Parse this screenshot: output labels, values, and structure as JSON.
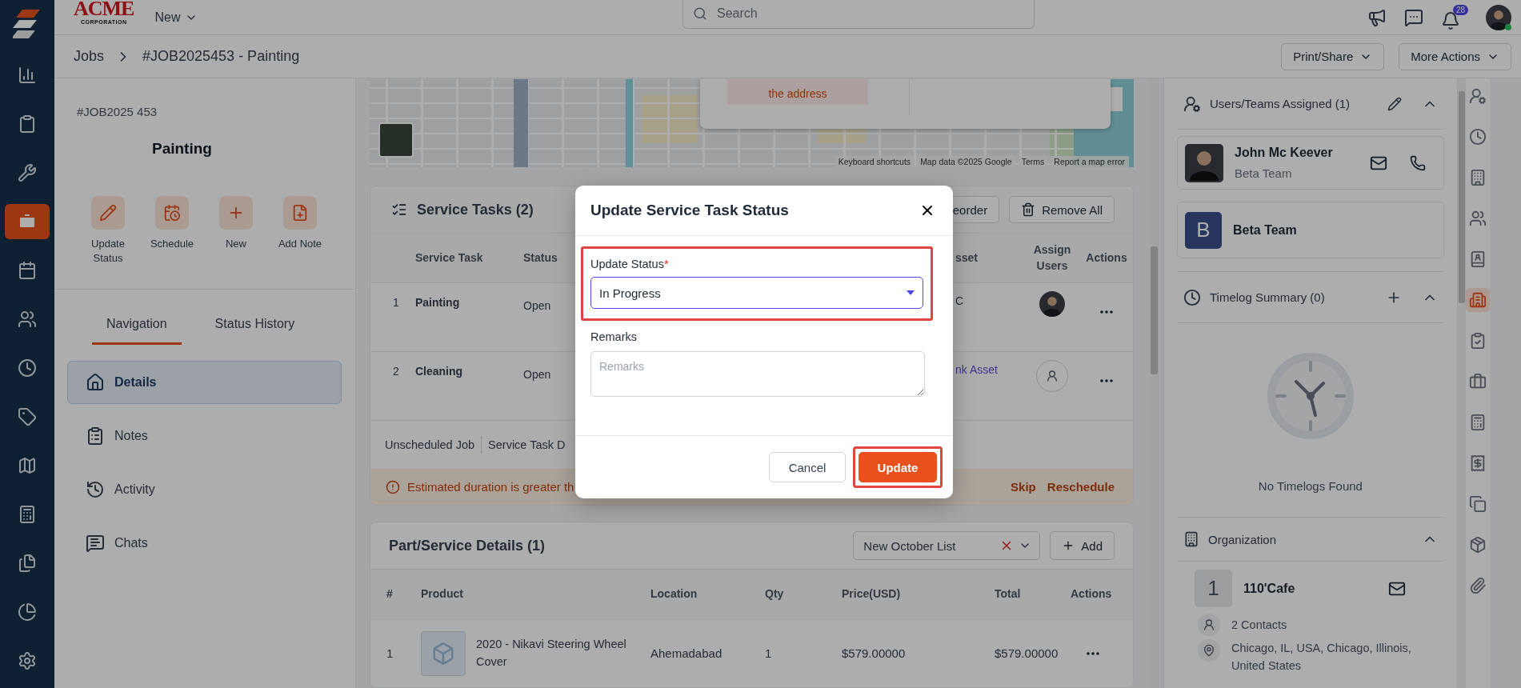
{
  "app_rail": [
    {
      "selected": false
    },
    {
      "selected": false
    },
    {
      "selected": false
    },
    {
      "selected": true
    },
    {
      "selected": false
    },
    {
      "selected": false
    },
    {
      "selected": false
    },
    {
      "selected": false
    },
    {
      "selected": false
    },
    {
      "selected": false
    },
    {
      "selected": false
    },
    {
      "selected": false
    },
    {
      "selected": false
    }
  ],
  "top_bar": {
    "brand": "ACME",
    "brand_tagline": "CORPORATION",
    "new_menu": "New",
    "search": {
      "placeholder": "Search"
    },
    "notification_count": "28"
  },
  "breadcrumb": [
    "Jobs",
    "#JOB2025453 - Painting"
  ],
  "header_actions": [
    "Print/Share",
    "More Actions"
  ],
  "job": {
    "number": "#JOB2025 453",
    "title": "Painting",
    "quick_actions": [
      "Update Status",
      "Schedule",
      "New",
      "Add Note"
    ]
  },
  "tabs": [
    {
      "label": "Navigation",
      "selected": true
    },
    {
      "label": "Status History",
      "selected": false
    }
  ],
  "nav": [
    {
      "label": "Details",
      "selected": true
    },
    {
      "label": "Notes",
      "selected": false
    },
    {
      "label": "Activity",
      "selected": false
    },
    {
      "label": "Chats",
      "selected": false
    }
  ],
  "map": {
    "popup_text": "the address",
    "attribution": [
      "Keyboard shortcuts",
      "Map data ©2025 Google",
      "Terms",
      "Report a map error"
    ]
  },
  "service_tasks": {
    "title": "Service Tasks (2)",
    "buttons": [
      "eorder",
      "Remove All"
    ],
    "columns": [
      "Service Task",
      "Status",
      "sset",
      "Assign Users",
      "Actions"
    ],
    "rows": [
      {
        "index": "1",
        "task": "Painting",
        "status": "Open",
        "asset": {
          "text": "C",
          "kind": "text"
        },
        "assignee": {
          "kind": "avatar"
        }
      },
      {
        "index": "2",
        "task": "Cleaning",
        "status": "Open",
        "asset": {
          "text": "nk Asset",
          "kind": "link"
        },
        "assignee": {
          "kind": "empty"
        }
      }
    ],
    "footer": [
      "Unscheduled Job",
      "Service Task D"
    ],
    "warning": {
      "text": "Estimated duration is greater th",
      "actions": [
        "Skip",
        "Reschedule"
      ]
    }
  },
  "parts": {
    "title": "Part/Service Details (1)",
    "price_list": "New October List",
    "add_button": "Add",
    "columns": [
      "#",
      "Product",
      "Location",
      "Qty",
      "Price(USD)",
      "Total",
      "Actions"
    ],
    "rows": [
      {
        "index": "1",
        "product": "2020 - Nikavi Steering Wheel Cover",
        "location": "Ahemadabad",
        "qty": "1",
        "price": "$579.00000",
        "total": "$579.00000"
      }
    ]
  },
  "right_panel": {
    "assigned": {
      "title": "Users/Teams Assigned (1)",
      "members": [
        {
          "kind": "user",
          "name": "John Mc Keever",
          "team": "Beta Team"
        },
        {
          "kind": "team",
          "initial": "B",
          "name": "Beta Team"
        }
      ]
    },
    "timelog": {
      "title": "Timelog Summary (0)",
      "empty_text": "No Timelogs Found"
    },
    "organization": {
      "title": "Organization",
      "initial": "1",
      "name": "110'Cafe",
      "contacts": "2 Contacts",
      "address": "Chicago, IL, USA, Chicago, Illinois, United States"
    }
  },
  "side_rail": [
    {
      "selected": false
    },
    {
      "selected": false
    },
    {
      "selected": false
    },
    {
      "selected": false
    },
    {
      "selected": false
    },
    {
      "selected": true
    },
    {
      "selected": false
    },
    {
      "selected": false
    },
    {
      "selected": false
    },
    {
      "selected": false
    },
    {
      "selected": false
    },
    {
      "selected": false
    },
    {
      "selected": false
    }
  ],
  "modal": {
    "title": "Update Service Task Status",
    "status_label": "Update Status",
    "required_mark": "*",
    "status_value": "In Progress",
    "status_highlighted": true,
    "remarks_label": "Remarks",
    "remarks_placeholder": "Remarks",
    "buttons": [
      {
        "label": "Cancel",
        "kind": "secondary",
        "highlighted": false
      },
      {
        "label": "Update",
        "kind": "primary",
        "highlighted": true
      }
    ]
  }
}
